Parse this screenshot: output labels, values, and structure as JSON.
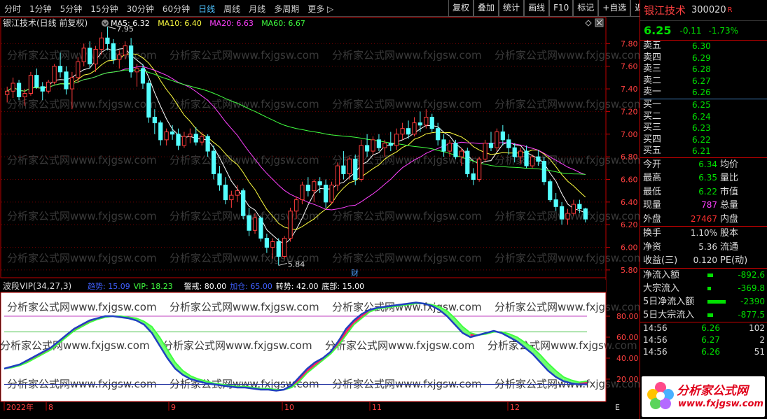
{
  "toolbar": {
    "periods": [
      {
        "label": "分时",
        "active": false
      },
      {
        "label": "1分钟",
        "active": false
      },
      {
        "label": "5分钟",
        "active": false
      },
      {
        "label": "15分钟",
        "active": false
      },
      {
        "label": "30分钟",
        "active": false
      },
      {
        "label": "60分钟",
        "active": false
      },
      {
        "label": "日线",
        "active": true
      },
      {
        "label": "周线",
        "active": false
      },
      {
        "label": "月线",
        "active": false
      },
      {
        "label": "多周期",
        "active": false
      },
      {
        "label": "更多",
        "active": false
      }
    ],
    "buttons": [
      "复权",
      "叠加",
      "统计",
      "画线",
      "F10",
      "标记",
      "+自选",
      "返回"
    ]
  },
  "main_chart": {
    "title": "银江技术(日线 前复权)",
    "ma": [
      {
        "label": "MA5: 6.32",
        "color": "#ffffff"
      },
      {
        "label": "MA10: 6.40",
        "color": "#ffff40"
      },
      {
        "label": "MA20: 6.63",
        "color": "#ff40ff"
      },
      {
        "label": "MA60: 6.67",
        "color": "#40ff40"
      }
    ],
    "high_mark": "7.95",
    "low_mark": "5.84",
    "finance_mark": "财",
    "y_ticks": [
      "7.80",
      "7.60",
      "7.40",
      "7.20",
      "7.00",
      "6.80",
      "6.60",
      "6.40",
      "6.20",
      "6.00",
      "5.80"
    ]
  },
  "indicator": {
    "name": "波段VIP(34,27,3)",
    "items": [
      {
        "label": "趋势: 15.09",
        "color": "#4060ff"
      },
      {
        "label": "VIP: 18.23",
        "color": "#40ff40"
      },
      {
        "label": "警戒: 80.00",
        "color": "#ffffff"
      },
      {
        "label": "加仓: 65.00",
        "color": "#4060ff"
      },
      {
        "label": "转势: 42.00",
        "color": "#ffffff"
      },
      {
        "label": "底部: 15.00",
        "color": "#ffffff"
      }
    ],
    "y_ticks": [
      "80.00",
      "60.00",
      "40.00",
      "20.00"
    ]
  },
  "x_axis": {
    "labels": [
      "2022年",
      "8",
      "9",
      "10",
      "11",
      "12"
    ],
    "corner": "E"
  },
  "watermark": "分析家公式网www.fxjgsw.com",
  "chart_data": {
    "type": "candlestick",
    "title": "银江技术(日线 前复权)",
    "ylim": [
      5.75,
      8.0
    ],
    "high": 7.95,
    "low": 5.84,
    "candles": [
      [
        7.35,
        7.42,
        7.28,
        7.38
      ],
      [
        7.38,
        7.5,
        7.32,
        7.45
      ],
      [
        7.45,
        7.48,
        7.3,
        7.33
      ],
      [
        7.33,
        7.4,
        7.25,
        7.36
      ],
      [
        7.36,
        7.55,
        7.34,
        7.52
      ],
      [
        7.52,
        7.58,
        7.4,
        7.42
      ],
      [
        7.42,
        7.46,
        7.3,
        7.38
      ],
      [
        7.38,
        7.48,
        7.36,
        7.46
      ],
      [
        7.46,
        7.62,
        7.44,
        7.6
      ],
      [
        7.6,
        7.72,
        7.5,
        7.55
      ],
      [
        7.55,
        7.6,
        7.35,
        7.4
      ],
      [
        7.4,
        7.55,
        7.22,
        7.5
      ],
      [
        7.5,
        7.68,
        7.45,
        7.64
      ],
      [
        7.64,
        7.8,
        7.6,
        7.76
      ],
      [
        7.76,
        7.82,
        7.58,
        7.62
      ],
      [
        7.62,
        7.78,
        7.55,
        7.75
      ],
      [
        7.75,
        7.9,
        7.7,
        7.85
      ],
      [
        7.85,
        7.95,
        7.74,
        7.8
      ],
      [
        7.8,
        7.84,
        7.62,
        7.66
      ],
      [
        7.66,
        7.74,
        7.58,
        7.7
      ],
      [
        7.7,
        7.82,
        7.66,
        7.78
      ],
      [
        7.78,
        7.85,
        7.5,
        7.55
      ],
      [
        7.55,
        7.62,
        7.42,
        7.58
      ],
      [
        7.58,
        7.62,
        7.4,
        7.45
      ],
      [
        7.45,
        7.48,
        7.1,
        7.15
      ],
      [
        7.15,
        7.22,
        7.0,
        7.1
      ],
      [
        7.1,
        7.12,
        6.9,
        6.95
      ],
      [
        6.95,
        7.05,
        6.9,
        7.02
      ],
      [
        7.02,
        7.08,
        6.95,
        7.0
      ],
      [
        7.0,
        7.05,
        6.86,
        6.9
      ],
      [
        6.9,
        7.02,
        6.88,
        6.98
      ],
      [
        6.98,
        7.05,
        6.92,
        7.0
      ],
      [
        7.0,
        7.06,
        6.9,
        6.93
      ],
      [
        6.93,
        7.02,
        6.9,
        6.98
      ],
      [
        6.98,
        7.0,
        6.8,
        6.85
      ],
      [
        6.85,
        6.9,
        6.6,
        6.65
      ],
      [
        6.65,
        6.72,
        6.5,
        6.55
      ],
      [
        6.55,
        6.62,
        6.38,
        6.42
      ],
      [
        6.42,
        6.5,
        6.35,
        6.46
      ],
      [
        6.46,
        6.55,
        6.4,
        6.5
      ],
      [
        6.5,
        6.52,
        6.25,
        6.28
      ],
      [
        6.28,
        6.35,
        6.1,
        6.15
      ],
      [
        6.15,
        6.3,
        6.12,
        6.26
      ],
      [
        6.26,
        6.28,
        6.05,
        6.08
      ],
      [
        6.08,
        6.12,
        5.95,
        6.0
      ],
      [
        6.0,
        6.08,
        5.9,
        6.05
      ],
      [
        6.05,
        6.08,
        5.84,
        5.92
      ],
      [
        5.92,
        6.1,
        5.9,
        6.08
      ],
      [
        6.08,
        6.35,
        6.05,
        6.32
      ],
      [
        6.32,
        6.45,
        6.25,
        6.42
      ],
      [
        6.42,
        6.58,
        6.38,
        6.55
      ],
      [
        6.55,
        6.62,
        6.45,
        6.5
      ],
      [
        6.5,
        6.6,
        6.4,
        6.58
      ],
      [
        6.58,
        6.62,
        6.48,
        6.55
      ],
      [
        6.55,
        6.6,
        6.35,
        6.4
      ],
      [
        6.4,
        6.58,
        6.38,
        6.55
      ],
      [
        6.55,
        6.75,
        6.5,
        6.72
      ],
      [
        6.72,
        6.85,
        6.6,
        6.65
      ],
      [
        6.65,
        6.8,
        6.6,
        6.78
      ],
      [
        6.78,
        6.82,
        6.55,
        6.6
      ],
      [
        6.6,
        6.95,
        6.58,
        6.9
      ],
      [
        6.9,
        7.0,
        6.8,
        6.85
      ],
      [
        6.85,
        6.98,
        6.82,
        6.95
      ],
      [
        6.95,
        7.0,
        6.85,
        6.88
      ],
      [
        6.88,
        6.95,
        6.8,
        6.92
      ],
      [
        6.92,
        7.02,
        6.85,
        6.9
      ],
      [
        6.9,
        7.05,
        6.86,
        7.0
      ],
      [
        7.0,
        7.1,
        6.95,
        7.05
      ],
      [
        7.05,
        7.12,
        6.96,
        7.0
      ],
      [
        7.0,
        7.15,
        6.98,
        7.1
      ],
      [
        7.1,
        7.2,
        7.02,
        7.08
      ],
      [
        7.08,
        7.22,
        7.05,
        7.15
      ],
      [
        7.15,
        7.18,
        7.02,
        7.05
      ],
      [
        7.05,
        7.1,
        6.9,
        6.95
      ],
      [
        6.95,
        7.0,
        6.8,
        6.85
      ],
      [
        6.85,
        6.95,
        6.8,
        6.92
      ],
      [
        6.92,
        6.95,
        6.78,
        6.8
      ],
      [
        6.8,
        6.88,
        6.72,
        6.85
      ],
      [
        6.85,
        6.88,
        6.62,
        6.65
      ],
      [
        6.65,
        6.7,
        6.55,
        6.6
      ],
      [
        6.6,
        6.8,
        6.58,
        6.78
      ],
      [
        6.78,
        6.95,
        6.75,
        6.92
      ],
      [
        6.92,
        7.02,
        6.85,
        6.88
      ],
      [
        6.88,
        7.05,
        6.85,
        7.02
      ],
      [
        7.02,
        7.08,
        6.9,
        6.95
      ],
      [
        6.95,
        7.0,
        6.82,
        6.88
      ],
      [
        6.88,
        6.92,
        6.75,
        6.8
      ],
      [
        6.8,
        6.88,
        6.74,
        6.85
      ],
      [
        6.85,
        6.9,
        6.7,
        6.72
      ],
      [
        6.72,
        6.82,
        6.7,
        6.8
      ],
      [
        6.8,
        6.86,
        6.72,
        6.76
      ],
      [
        6.76,
        6.8,
        6.55,
        6.58
      ],
      [
        6.58,
        6.6,
        6.4,
        6.42
      ],
      [
        6.42,
        6.48,
        6.32,
        6.36
      ],
      [
        6.36,
        6.4,
        6.2,
        6.25
      ],
      [
        6.25,
        6.34,
        6.2,
        6.3
      ],
      [
        6.3,
        6.42,
        6.28,
        6.38
      ],
      [
        6.38,
        6.42,
        6.3,
        6.34
      ],
      [
        6.34,
        6.35,
        6.22,
        6.25
      ]
    ],
    "indicator_series": [
      {
        "name": "趋势",
        "values": [
          30,
          32,
          34,
          38,
          42,
          46,
          50,
          56,
          62,
          68,
          72,
          76,
          78,
          80,
          80,
          79,
          78,
          76,
          72,
          64,
          52,
          40,
          30,
          24,
          20,
          18,
          16,
          15,
          14,
          13,
          12,
          12,
          11,
          10,
          10,
          9,
          10,
          14,
          22,
          30,
          36,
          40,
          46,
          56,
          68,
          76,
          82,
          86,
          88,
          89,
          90,
          91,
          92,
          93,
          92,
          90,
          86,
          80,
          72,
          64,
          60,
          62,
          64,
          66,
          64,
          60,
          56,
          50,
          44,
          36,
          28,
          22,
          18,
          16,
          15,
          15
        ]
      },
      {
        "name": "VIP",
        "values": [
          30,
          31,
          33,
          36,
          40,
          44,
          48,
          54,
          60,
          66,
          70,
          74,
          77,
          79,
          80,
          80,
          79,
          78,
          75,
          70,
          60,
          48,
          36,
          28,
          23,
          20,
          18,
          16,
          15,
          14,
          13,
          13,
          12,
          11,
          11,
          10,
          10,
          12,
          18,
          26,
          32,
          38,
          44,
          52,
          62,
          72,
          78,
          84,
          87,
          88,
          89,
          90,
          91,
          92,
          92,
          91,
          89,
          85,
          78,
          70,
          64,
          62,
          63,
          65,
          65,
          63,
          60,
          55,
          50,
          43,
          35,
          28,
          22,
          19,
          17,
          18
        ]
      }
    ],
    "indicator_levels": {
      "警戒": 80.0,
      "加仓": 65.0,
      "转势": 42.0,
      "底部": 15.0
    }
  },
  "panel": {
    "stock_name": "银江技术",
    "stock_code": "300020",
    "code_mark": "R",
    "price": "6.25",
    "change": "-0.11",
    "change_pct": "-1.73%",
    "sell": [
      {
        "label": "卖五",
        "price": "6.30"
      },
      {
        "label": "卖四",
        "price": "6.29"
      },
      {
        "label": "卖三",
        "price": "6.28"
      },
      {
        "label": "卖二",
        "price": "6.27"
      },
      {
        "label": "卖一",
        "price": "6.26"
      }
    ],
    "buy": [
      {
        "label": "买一",
        "price": "6.25"
      },
      {
        "label": "买二",
        "price": "6.24"
      },
      {
        "label": "买三",
        "price": "6.23"
      },
      {
        "label": "买四",
        "price": "6.22"
      },
      {
        "label": "买五",
        "price": "6.21"
      }
    ],
    "quote": [
      {
        "label": "今开",
        "value": "6.34",
        "color": "g",
        "right": "均价"
      },
      {
        "label": "最高",
        "value": "6.35",
        "color": "g",
        "right": "量比"
      },
      {
        "label": "最低",
        "value": "6.22",
        "color": "g",
        "right": "市值"
      },
      {
        "label": "现量",
        "value": "787",
        "color": "m",
        "right": "总量"
      },
      {
        "label": "外盘",
        "value": "27467",
        "color": "r",
        "right": "内盘"
      }
    ],
    "stats": [
      {
        "label": "换手",
        "value": "1.10%",
        "right": "股本"
      },
      {
        "label": "净资",
        "value": "5.36",
        "right": "流通"
      },
      {
        "label": "收益(三)",
        "value": "0.120",
        "right": "PE(动)"
      }
    ],
    "flows": [
      {
        "label": "净流入额",
        "value": "-892.6",
        "bar": 8
      },
      {
        "label": "大宗流入",
        "value": "-369.8",
        "bar": 5
      },
      {
        "label": "5日净流入额",
        "value": "-2390",
        "bar": 26
      },
      {
        "label": "5日大宗流入",
        "value": "-877.5",
        "bar": 8
      }
    ],
    "ticks": [
      {
        "time": "14:56",
        "price": "6.26",
        "vol": "102"
      },
      {
        "time": "14:56",
        "price": "6.27",
        "vol": "2"
      },
      {
        "time": "14:56",
        "price": "6.26",
        "vol": "51"
      }
    ],
    "logo_text": "分析家公式网",
    "logo_url": "www.fxjgsw.com"
  }
}
